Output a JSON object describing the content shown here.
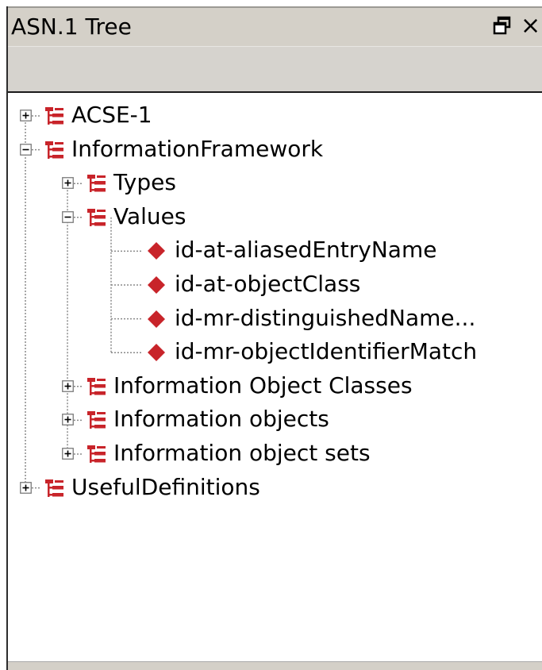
{
  "panel": {
    "title": "ASN.1 Tree",
    "float_icon": "float-window-icon",
    "close_icon": "close-icon",
    "close_glyph": "×"
  },
  "tree": {
    "nodes": [
      {
        "label": "ACSE-1",
        "depth": 0,
        "icon": "module-icon",
        "expander": "expand-icon"
      },
      {
        "label": "InformationFramework",
        "depth": 0,
        "icon": "module-icon",
        "expander": "collapse-icon"
      },
      {
        "label": "Types",
        "depth": 1,
        "icon": "module-icon",
        "expander": "expand-icon"
      },
      {
        "label": "Values",
        "depth": 1,
        "icon": "module-icon",
        "expander": "collapse-icon"
      },
      {
        "label": "id-at-aliasedEntryName",
        "depth": 2,
        "icon": "value-diamond-icon",
        "expander": null
      },
      {
        "label": "id-at-objectClass",
        "depth": 2,
        "icon": "value-diamond-icon",
        "expander": null
      },
      {
        "label": "id-mr-distinguishedName...",
        "depth": 2,
        "icon": "value-diamond-icon",
        "expander": null
      },
      {
        "label": "id-mr-objectIdentifierMatch",
        "depth": 2,
        "icon": "value-diamond-icon",
        "expander": null
      },
      {
        "label": "Information Object Classes",
        "depth": 1,
        "icon": "module-icon",
        "expander": "expand-icon"
      },
      {
        "label": "Information objects",
        "depth": 1,
        "icon": "module-icon",
        "expander": "expand-icon"
      },
      {
        "label": "Information object sets",
        "depth": 1,
        "icon": "module-icon",
        "expander": "expand-icon"
      },
      {
        "label": "UsefulDefinitions",
        "depth": 0,
        "icon": "module-icon",
        "expander": "expand-icon"
      }
    ]
  },
  "colors": {
    "icon_red": "#c8242a",
    "panel_gray": "#d4d0c8",
    "tree_line": "#8a8a8a"
  }
}
